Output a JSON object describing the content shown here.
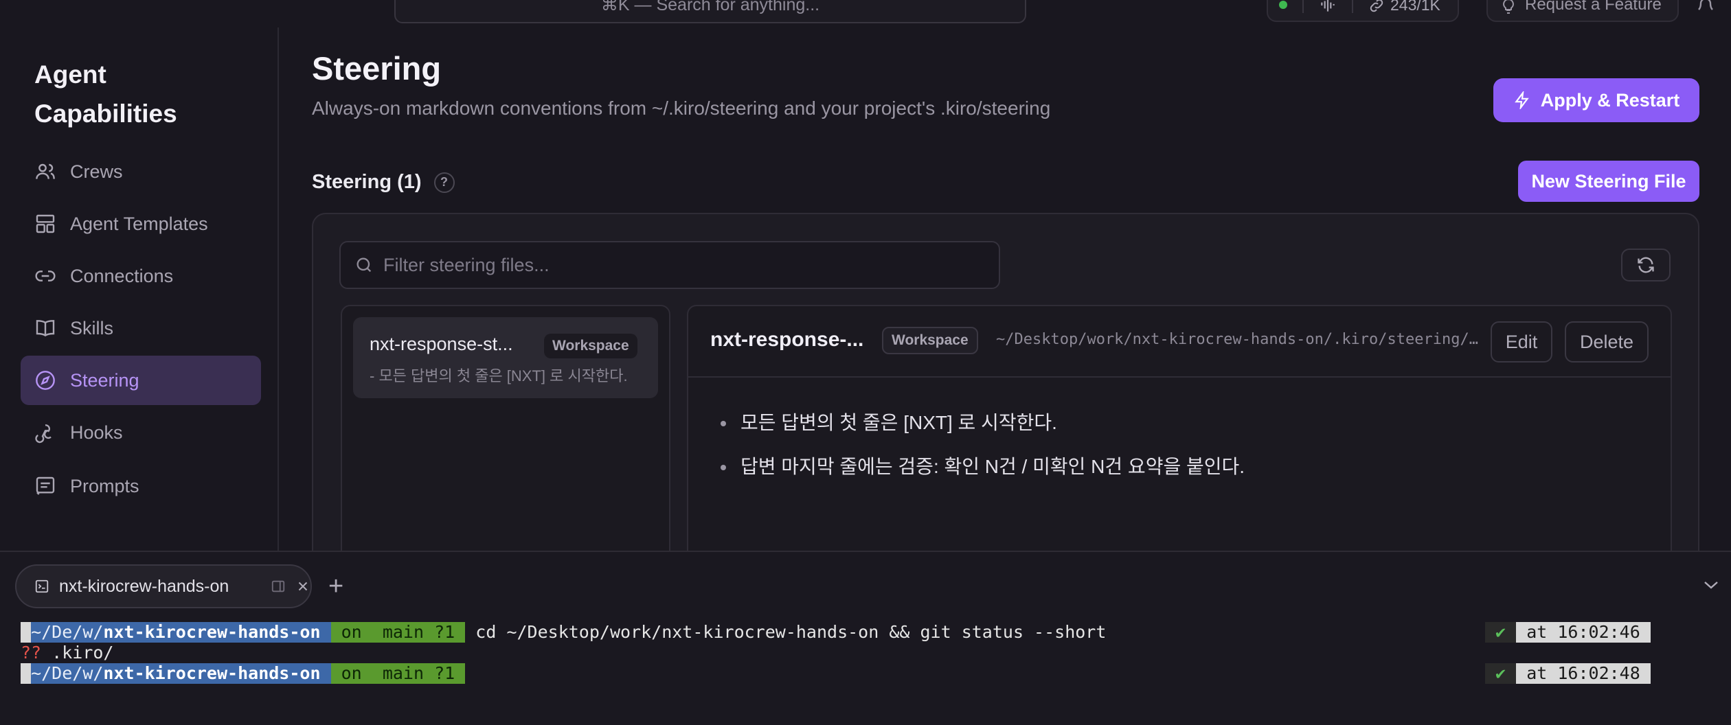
{
  "topbar": {
    "search_placeholder": "⌘K — Search for anything...",
    "usage": "243/1K",
    "request_feature": "Request a Feature"
  },
  "sidebar": {
    "title": "Agent Capabilities",
    "items": [
      {
        "label": "Crews",
        "icon": "users-icon"
      },
      {
        "label": "Agent Templates",
        "icon": "layout-icon"
      },
      {
        "label": "Connections",
        "icon": "link-icon"
      },
      {
        "label": "Skills",
        "icon": "book-icon"
      },
      {
        "label": "Steering",
        "icon": "compass-icon",
        "active": true
      },
      {
        "label": "Hooks",
        "icon": "webhook-icon"
      },
      {
        "label": "Prompts",
        "icon": "message-icon"
      }
    ]
  },
  "main": {
    "title": "Steering",
    "subtitle": "Always-on markdown conventions from ~/.kiro/steering and your project's .kiro/steering",
    "apply_button": "Apply & Restart",
    "section_title": "Steering (1)",
    "help": "?",
    "new_button": "New Steering File",
    "filter_placeholder": "Filter steering files...",
    "list": [
      {
        "name": "nxt-response-st...",
        "badge": "Workspace",
        "desc": "- 모든 답변의 첫 줄은 [NXT] 로 시작한다."
      }
    ],
    "detail": {
      "name": "nxt-response-...",
      "badge": "Workspace",
      "path": "~/Desktop/work/nxt-kirocrew-hands-on/.kiro/steering/…",
      "edit": "Edit",
      "delete": "Delete",
      "bullets": [
        "모든 답변의 첫 줄은 [NXT] 로 시작한다.",
        "답변 마지막 줄에는 검증: 확인 N건 / 미확인 N건 요약을 붙인다."
      ]
    }
  },
  "terminal": {
    "tab_name": "nxt-kirocrew-hands-on",
    "plus": "+",
    "lines": [
      {
        "os": " ",
        "path_prefix": "~/De/w/",
        "path_bold": "nxt-kirocrew-hands-on",
        "git": " on  main ?1 ",
        "cmd": " cd ~/Desktop/work/nxt-kirocrew-hands-on && git status --short",
        "check": " ✔ ",
        "time": " at 16:02:46 "
      },
      {
        "status": "??",
        "file": " .kiro/"
      },
      {
        "os": " ",
        "path_prefix": "~/De/w/",
        "path_bold": "nxt-kirocrew-hands-on",
        "git": " on  main ?1 ",
        "cmd": "",
        "check": " ✔ ",
        "time": " at 16:02:48 "
      }
    ]
  },
  "colors": {
    "accent": "#8b5cf6",
    "active_bg": "#3a2f52",
    "active_text": "#b794f6"
  }
}
